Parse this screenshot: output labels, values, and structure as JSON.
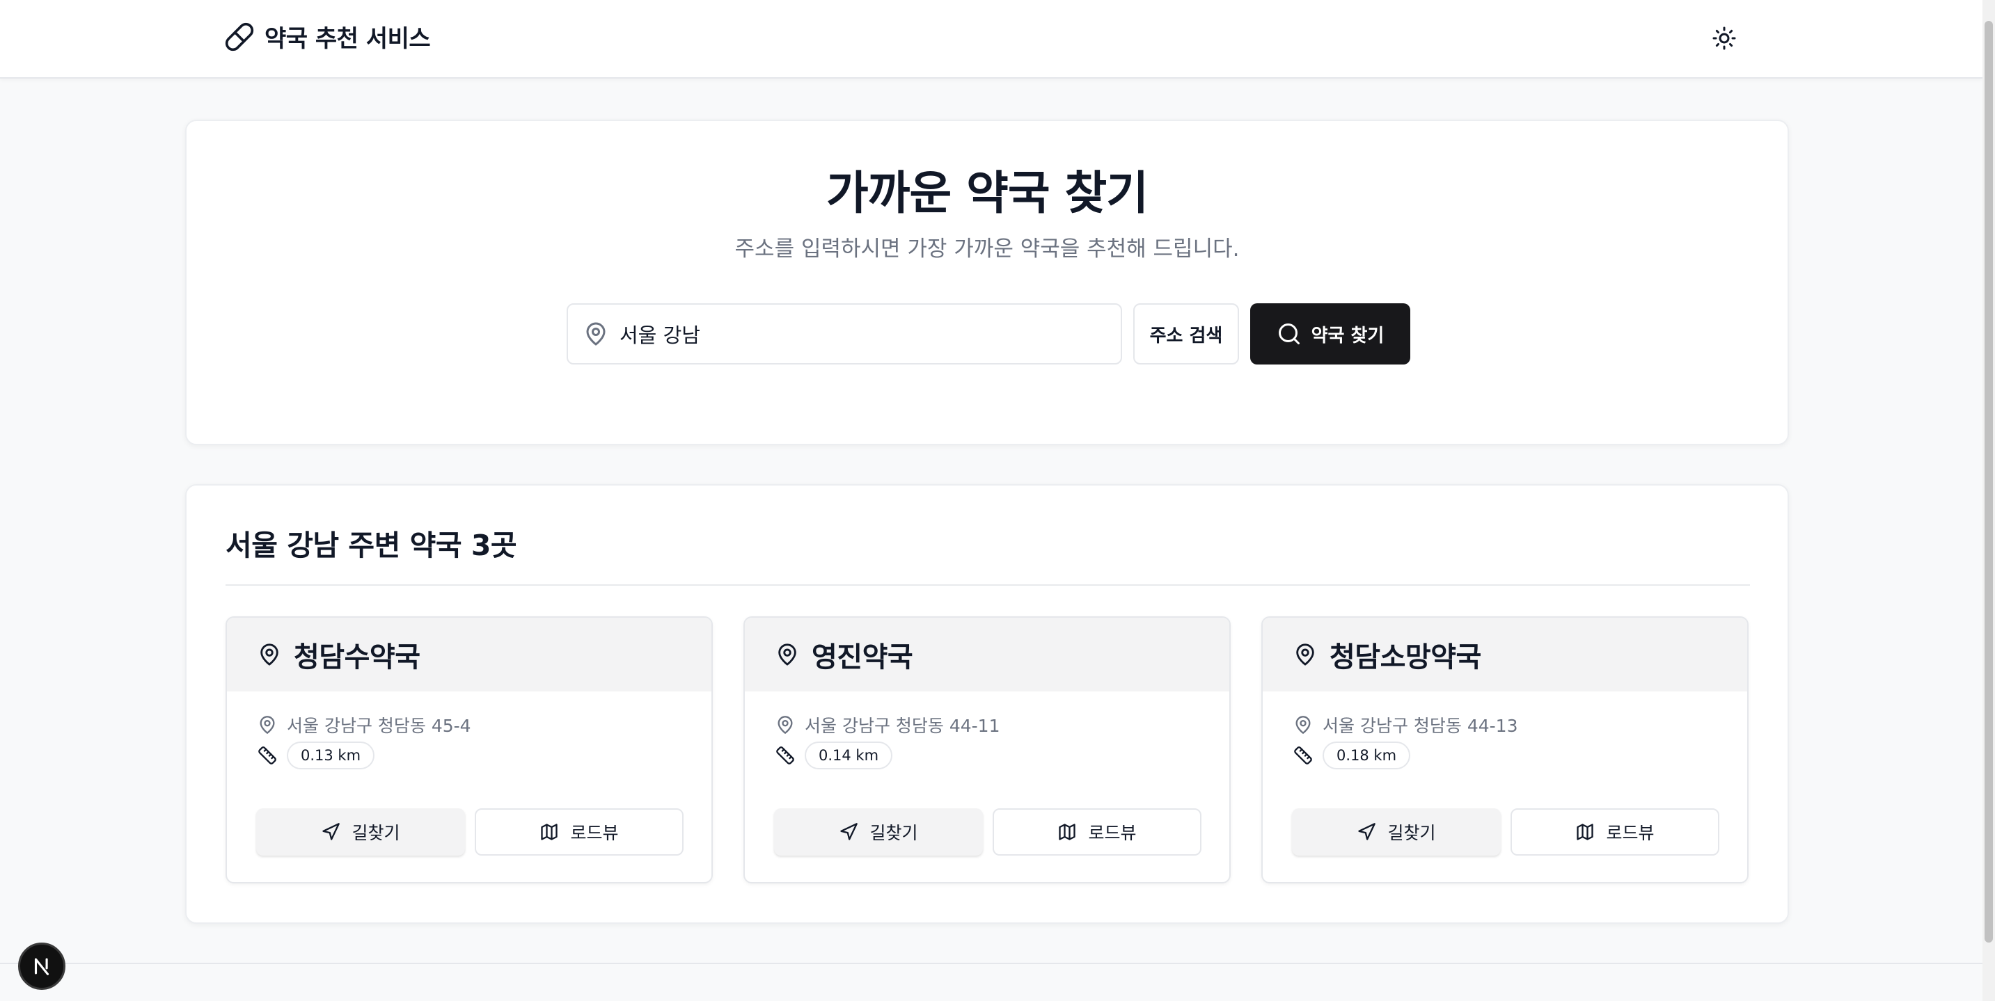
{
  "header": {
    "brand_icon": "pill-icon",
    "title": "약국 추천 서비스",
    "theme_toggle_icon": "sun-icon"
  },
  "search": {
    "title": "가까운 약국 찾기",
    "subtitle": "주소를 입력하시면 가장 가까운 약국을 추천해 드립니다.",
    "address_value": "서울 강남",
    "address_icon": "map-pin-icon",
    "address_search_label": "주소 검색",
    "find_button_label": "약국 찾기",
    "find_button_icon": "search-icon"
  },
  "results": {
    "heading": "서울 강남 주변 약국 3곳",
    "pharmacies": [
      {
        "name": "청담수약국",
        "address": "서울 강남구 청담동 45-4",
        "distance": "0.13 km",
        "directions_label": "길찾기",
        "roadview_label": "로드뷰"
      },
      {
        "name": "영진약국",
        "address": "서울 강남구 청담동 44-11",
        "distance": "0.14 km",
        "directions_label": "길찾기",
        "roadview_label": "로드뷰"
      },
      {
        "name": "청담소망약국",
        "address": "서울 강남구 청담동 44-13",
        "distance": "0.18 km",
        "directions_label": "길찾기",
        "roadview_label": "로드뷰"
      }
    ]
  },
  "dev_badge": {
    "icon": "nextjs-logo-icon"
  },
  "colors": {
    "primary_button": "#18181b",
    "card_header_bg": "#f3f3f4",
    "muted_text": "#6b7280",
    "page_bg": "#f8f9fa"
  }
}
